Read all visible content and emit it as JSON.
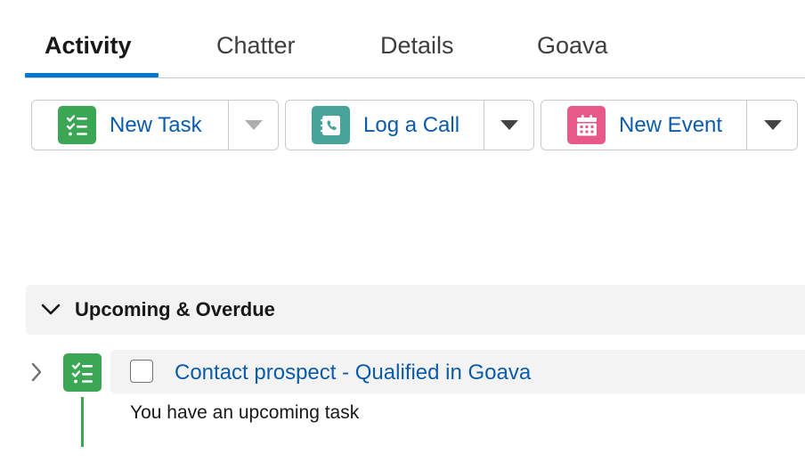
{
  "tabs": [
    {
      "label": "Activity",
      "active": true
    },
    {
      "label": "Chatter",
      "active": false
    },
    {
      "label": "Details",
      "active": false
    },
    {
      "label": "Goava",
      "active": false
    }
  ],
  "actions": [
    {
      "label": "New Task",
      "icon": "task-icon",
      "color": "#3ba755"
    },
    {
      "label": "Log a Call",
      "icon": "log-call-icon",
      "color": "#48a39b"
    },
    {
      "label": "New Event",
      "icon": "calendar-icon",
      "color": "#e8598a"
    }
  ],
  "section": {
    "title": "Upcoming & Overdue",
    "icon": "chevron-down-icon"
  },
  "item": {
    "subject": "Contact prospect - Qualified in Goava",
    "description": "You have an upcoming task",
    "icon": "task-icon",
    "completed": false
  },
  "colors": {
    "link": "#0b5cab",
    "active_tab": "#0176d3",
    "task": "#3ba755"
  }
}
